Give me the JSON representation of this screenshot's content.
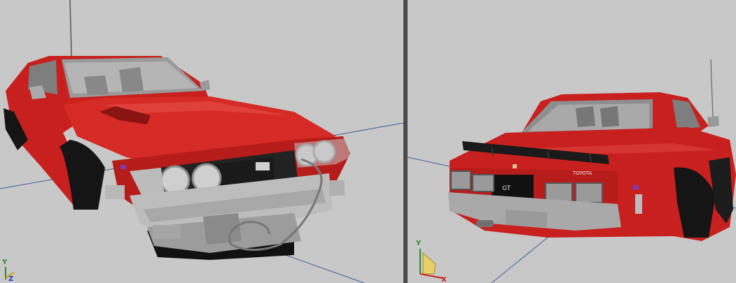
{
  "viewports": [
    {
      "id": "left",
      "view": "front-three-quarter",
      "gizmo": {
        "y_label": "Y",
        "z_label": "Z"
      }
    },
    {
      "id": "right",
      "view": "rear-three-quarter",
      "gizmo": {
        "y_label": "Y",
        "x_label": "X"
      },
      "badges": {
        "gt": "GT",
        "brand": "TOYOTA"
      }
    }
  ],
  "colors": {
    "background": "#c8c8c8",
    "car_body": "#c8201e",
    "chrome": "#bdbdbd",
    "grid_line": "#3f5f9a",
    "axis_y": "#2a8a2a",
    "axis_x": "#cc2222",
    "axis_z": "#2244cc"
  }
}
